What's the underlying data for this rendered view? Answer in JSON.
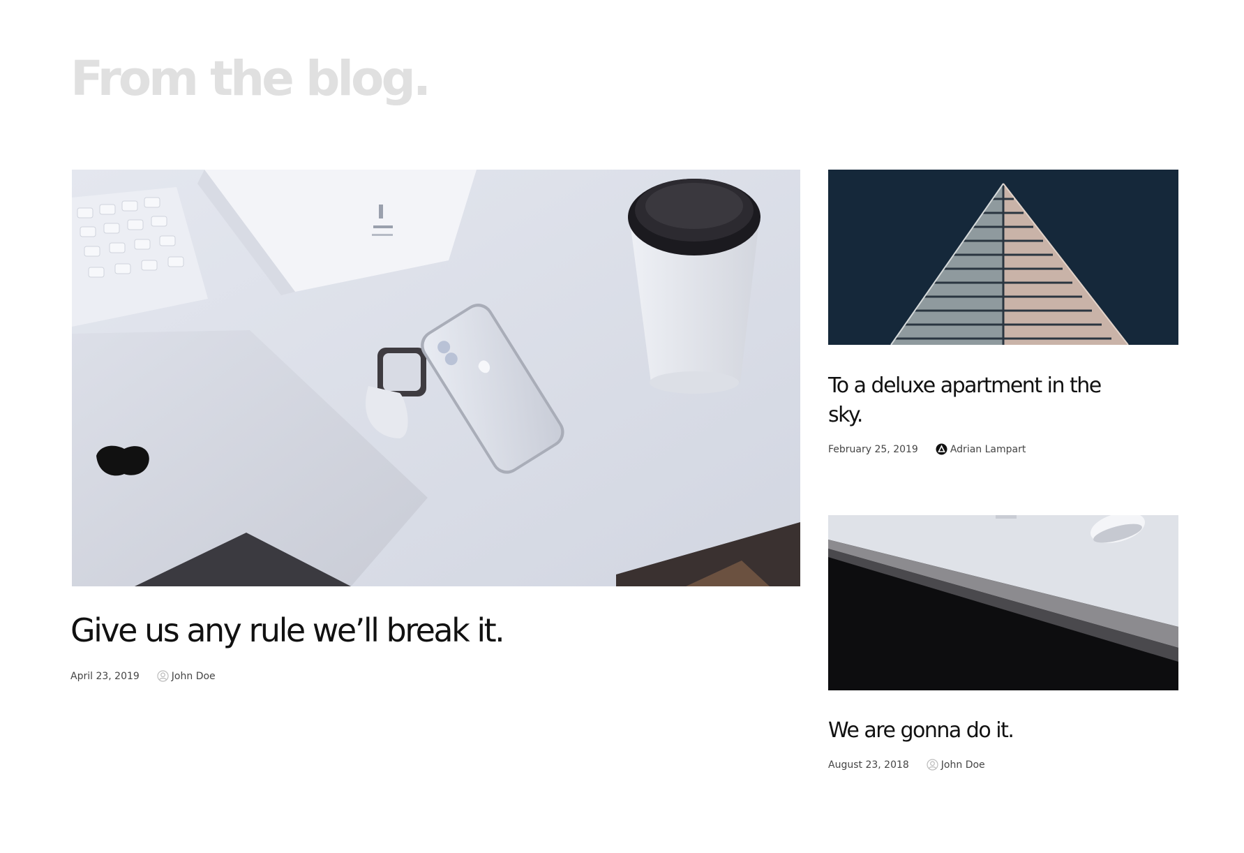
{
  "section": {
    "heading": "From the blog."
  },
  "posts": [
    {
      "title": "Give us any rule we’ll break it.",
      "date": "April 23, 2019",
      "author": "John Doe",
      "author_icon": "user-avatar-icon",
      "image": "desk-with-apple-devices"
    },
    {
      "title": "To a deluxe apartment in the sky.",
      "date": "February 25, 2019",
      "author": "Adrian Lampart",
      "author_icon": "author-logo-icon",
      "image": "skyscraper-against-night-sky"
    },
    {
      "title": "We are gonna do it.",
      "date": "August 23, 2018",
      "author": "John Doe",
      "author_icon": "user-avatar-icon",
      "image": "desk-edge-with-mouse"
    }
  ],
  "colors": {
    "heading": "#e0e0e0",
    "title": "#111111",
    "meta": "#444444",
    "background": "#ffffff"
  }
}
